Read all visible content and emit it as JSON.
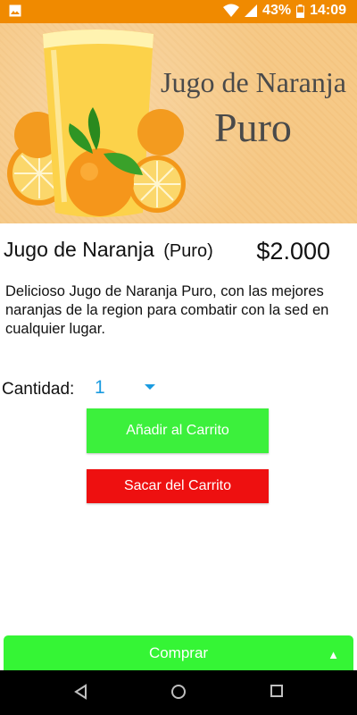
{
  "status_bar": {
    "battery": "43%",
    "time": "14:09",
    "icons": [
      "image-icon",
      "wifi-icon",
      "signal-icon",
      "battery-icon"
    ]
  },
  "banner": {
    "title_line1": "Jugo de Naranja",
    "title_line2": "Puro"
  },
  "product": {
    "name": "Jugo de Naranja",
    "variant": "(Puro)",
    "price": "$2.000",
    "description": "Delicioso Jugo de Naranja Puro, con las mejores naranjas de la region para combatir con la sed en cualquier lugar."
  },
  "quantity": {
    "label": "Cantidad:",
    "selected": "1"
  },
  "buttons": {
    "add_label": "Añadir al Carrito",
    "remove_label": "Sacar del Carrito",
    "buy_label": "Comprar",
    "buy_caret": "▲"
  },
  "colors": {
    "status_bar": "#f08a00",
    "add_button": "#3cf03c",
    "remove_button": "#ee1010",
    "buy_bar": "#35f535",
    "quantity_accent": "#1a9be0"
  },
  "nav": {
    "icons": [
      "back-icon",
      "home-icon",
      "recents-icon"
    ]
  }
}
